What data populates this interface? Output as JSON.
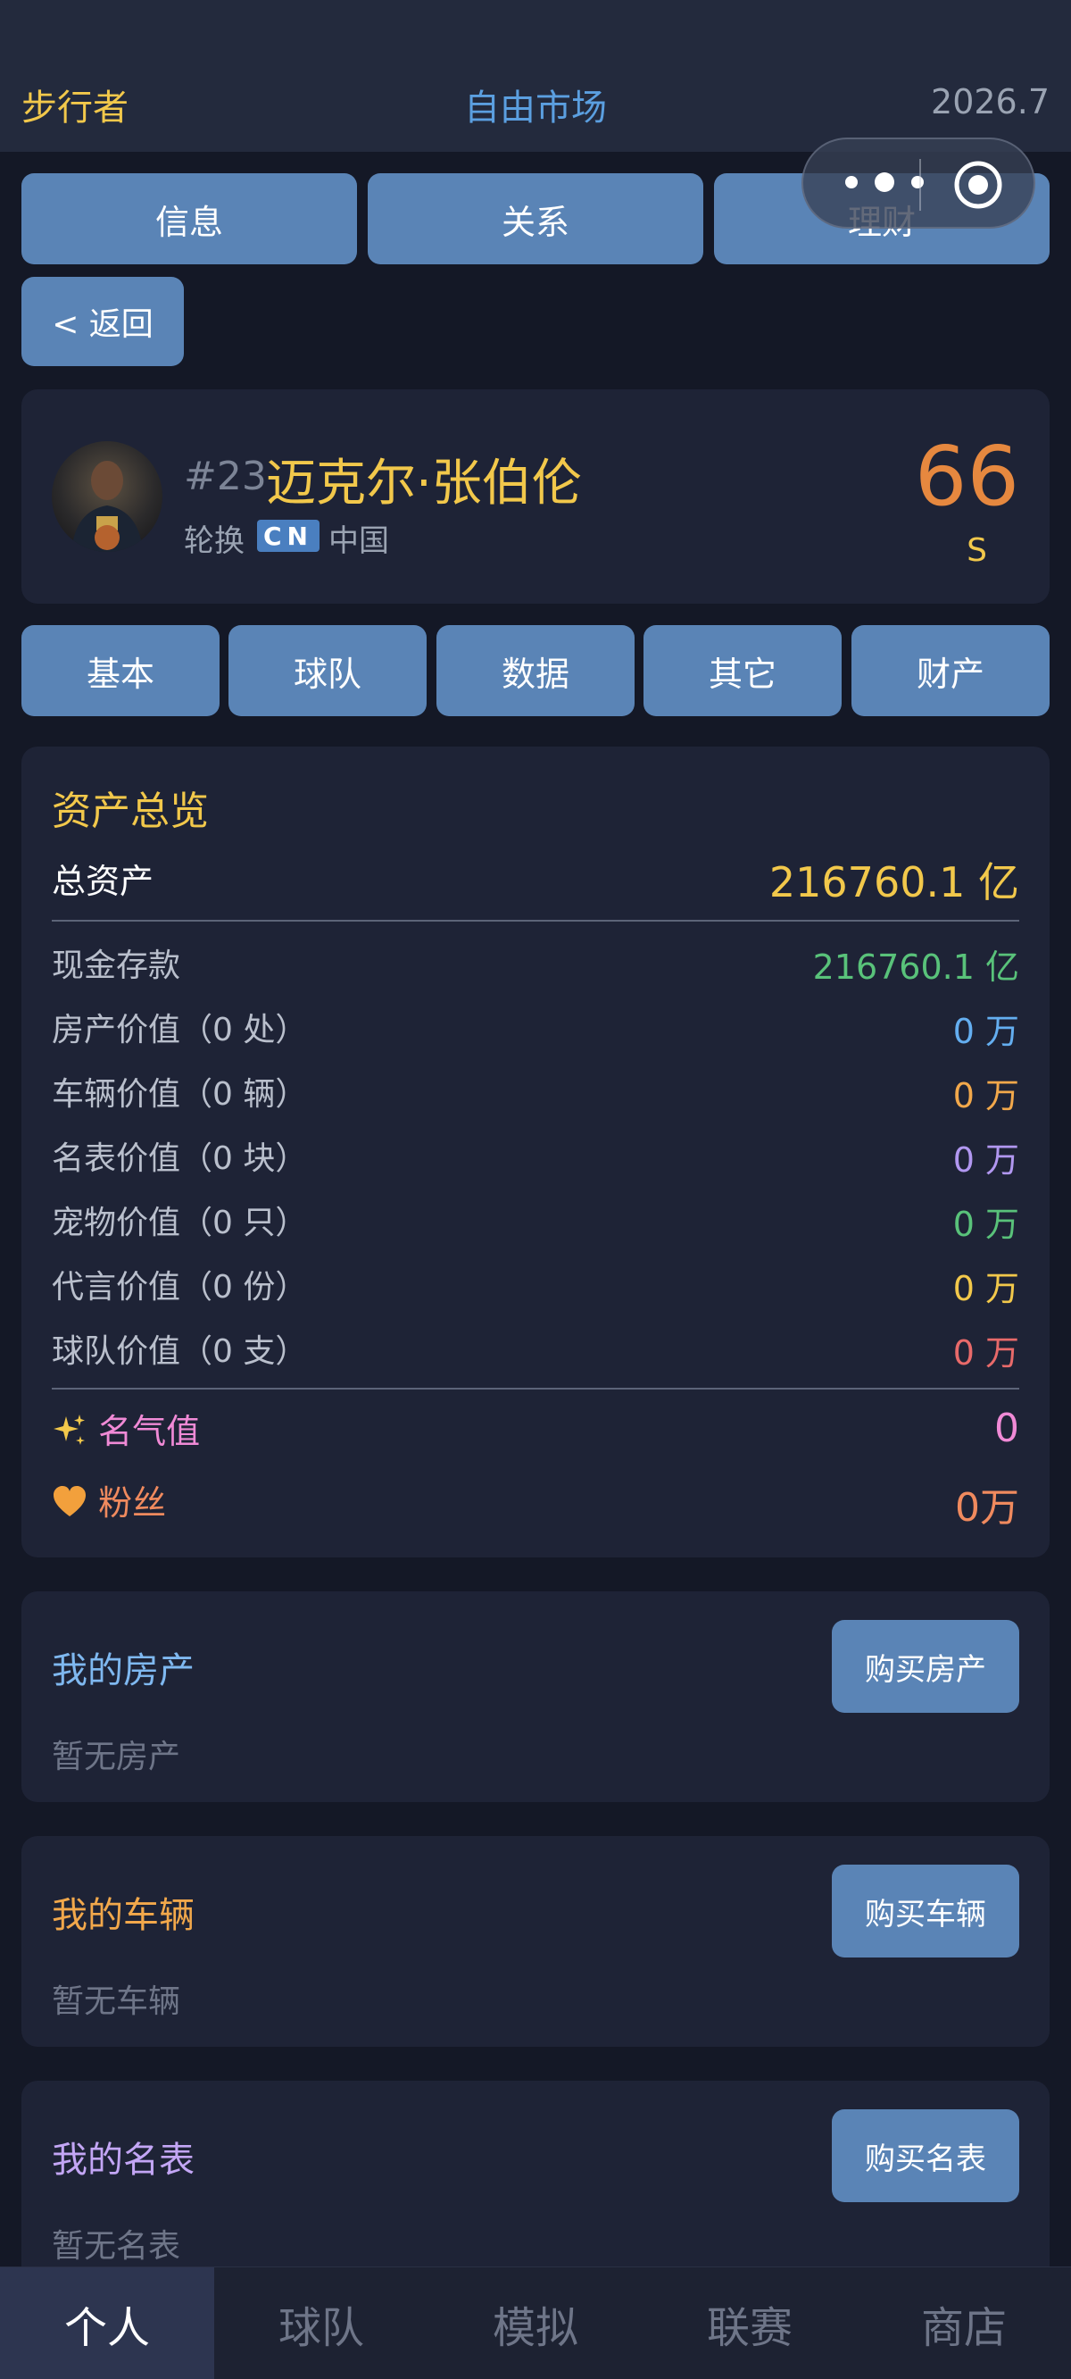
{
  "header": {
    "left_title": "步行者",
    "center_title": "自由市场",
    "date": "2026.7"
  },
  "top_tabs": [
    {
      "label": "信息"
    },
    {
      "label": "关系"
    },
    {
      "label": "理财"
    }
  ],
  "back_button": "< 返回",
  "player": {
    "number": "#23",
    "name": "迈克尔·张伯伦",
    "role": "轮换",
    "country_code": "CN",
    "country": "中国",
    "rating": "66",
    "grade": "S"
  },
  "sub_tabs": [
    {
      "label": "基本"
    },
    {
      "label": "球队"
    },
    {
      "label": "数据"
    },
    {
      "label": "其它"
    },
    {
      "label": "财产"
    }
  ],
  "assets": {
    "title": "资产总览",
    "total_label": "总资产",
    "total_value": "216760.1 亿",
    "rows": [
      {
        "label": "现金存款",
        "value": "216760.1 亿",
        "color": "#59c27a"
      },
      {
        "label": "房产价值（0 处）",
        "value": "0 万",
        "color": "#64aef0"
      },
      {
        "label": "车辆价值（0 辆）",
        "value": "0 万",
        "color": "#f2a84b"
      },
      {
        "label": "名表价值（0 块）",
        "value": "0 万",
        "color": "#b197f0"
      },
      {
        "label": "宠物价值（0 只）",
        "value": "0 万",
        "color": "#59c27a"
      },
      {
        "label": "代言价值（0 份）",
        "value": "0 万",
        "color": "#f2c84b"
      },
      {
        "label": "球队价值（0 支）",
        "value": "0 万",
        "color": "#e86a6a"
      }
    ],
    "fame": {
      "icon": "sparkles-icon",
      "label": "名气值",
      "value": "0",
      "color": "#f08ad6"
    },
    "fans": {
      "icon": "heart-icon",
      "label": "粉丝",
      "value": "0万",
      "color": "#f08a5e"
    }
  },
  "sections": [
    {
      "title": "我的房产",
      "title_color": "#7fb8f0",
      "empty": "暂无房产",
      "button": "购买房产"
    },
    {
      "title": "我的车辆",
      "title_color": "#f2a84b",
      "empty": "暂无车辆",
      "button": "购买车辆"
    },
    {
      "title": "我的名表",
      "title_color": "#c3a6f5",
      "empty": "暂无名表",
      "button": "购买名表"
    }
  ],
  "bottom_nav": [
    {
      "label": "个人",
      "active": true
    },
    {
      "label": "球队",
      "active": false
    },
    {
      "label": "模拟",
      "active": false
    },
    {
      "label": "联赛",
      "active": false
    },
    {
      "label": "商店",
      "active": false
    }
  ],
  "colors": {
    "background": "#141826",
    "card": "#1e2336",
    "accent_blue": "#5a84b6",
    "gold": "#f2c84b",
    "rating_orange": "#e6883f"
  }
}
